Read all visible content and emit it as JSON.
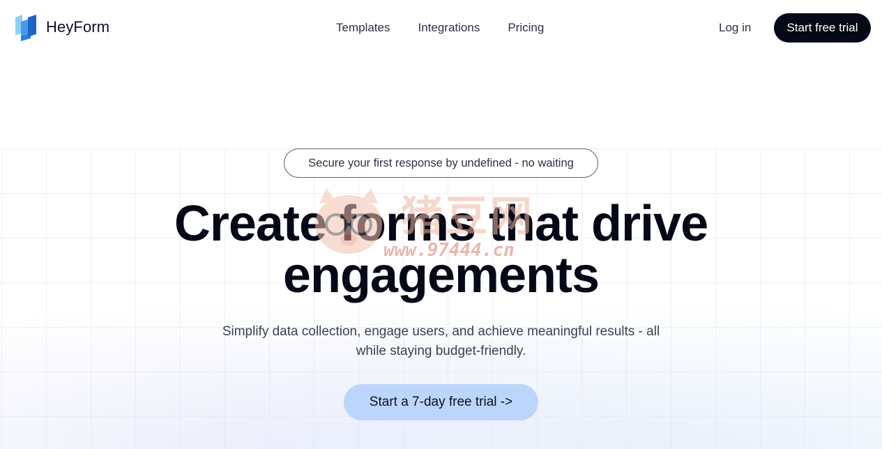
{
  "brand": {
    "name": "HeyForm",
    "logo_icon": "heyform-logo-icon",
    "color_light": "#8ed1f5",
    "color_dark": "#2a7de1"
  },
  "nav": {
    "items": [
      {
        "label": "Templates"
      },
      {
        "label": "Integrations"
      },
      {
        "label": "Pricing"
      }
    ],
    "login_label": "Log in",
    "cta_label": "Start free trial"
  },
  "hero": {
    "badge": "Secure your first response by undefined - no waiting",
    "headline_line1": "Create forms that drive",
    "headline_line2": "engagements",
    "subtitle": "Simplify data collection, engage users, and achieve meaningful results - all while staying budget-friendly.",
    "cta_label": "Start a 7-day free trial ->"
  },
  "watermark": {
    "title": "猪豆网",
    "url": "www.97444.cn",
    "icon": "pig-icon"
  },
  "colors": {
    "cta_dark": "#050816",
    "cta_light": "#bcd5fb",
    "text_main": "#050816"
  }
}
